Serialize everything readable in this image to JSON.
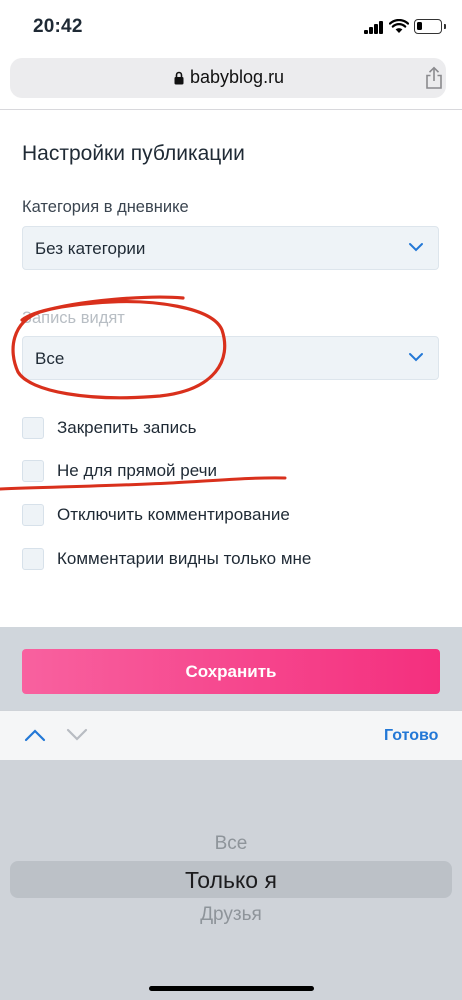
{
  "status_bar": {
    "time": "20:42"
  },
  "browser": {
    "url": "babyblog.ru"
  },
  "form": {
    "title": "Настройки публикации",
    "category": {
      "label": "Категория в дневнике",
      "value": "Без категории"
    },
    "visibility": {
      "label": "Запись видят",
      "value": "Все"
    },
    "checkboxes": [
      {
        "label": "Закрепить запись",
        "checked": false
      },
      {
        "label": "Не для прямой речи",
        "checked": false
      },
      {
        "label": "Отключить комментирование",
        "checked": false
      },
      {
        "label": "Комментарии видны только мне",
        "checked": false
      }
    ],
    "save_label": "Сохранить"
  },
  "keyboard_toolbar": {
    "done_label": "Готово"
  },
  "picker": {
    "options": [
      "Все",
      "Только я",
      "Друзья"
    ],
    "selected": "Только я"
  },
  "colors": {
    "accent_pink": "#f42f7e",
    "link_blue": "#2378d6",
    "annotation_red": "#d9301c",
    "field_bg": "#eef3f7"
  }
}
